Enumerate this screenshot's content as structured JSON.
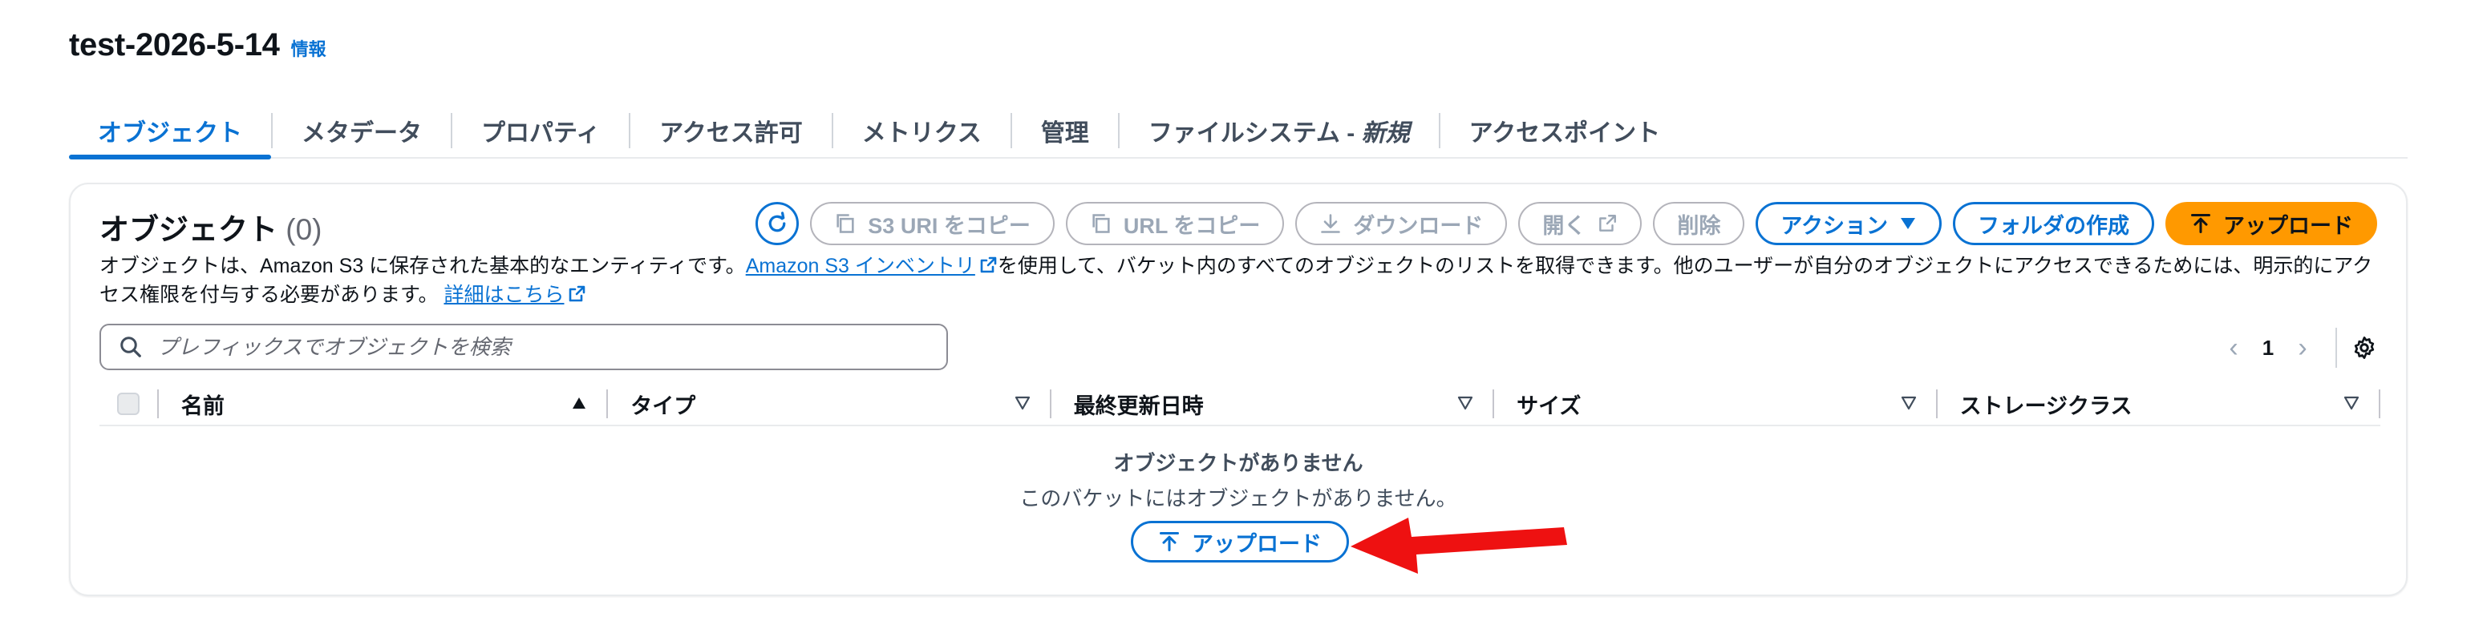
{
  "header": {
    "title": "test-2026-5-14",
    "info_link": "情報"
  },
  "tabs": [
    {
      "label": "オブジェクト",
      "active": true
    },
    {
      "label": "メタデータ"
    },
    {
      "label": "プロパティ"
    },
    {
      "label": "アクセス許可"
    },
    {
      "label": "メトリクス"
    },
    {
      "label": "管理"
    },
    {
      "label_prefix": "ファイルシステム - ",
      "label_italic": "新規"
    },
    {
      "label": "アクセスポイント"
    }
  ],
  "objects_panel": {
    "title": "オブジェクト",
    "count": "(0)",
    "toolbar": {
      "refresh_icon": "refresh-icon",
      "copy_s3_uri": "S3 URI をコピー",
      "copy_url": "URL をコピー",
      "download": "ダウンロード",
      "open": "開く",
      "delete": "削除",
      "actions": "アクション",
      "create_folder": "フォルダの作成",
      "upload": "アップロード"
    },
    "description": {
      "part1": "オブジェクトは、Amazon S3 に保存された基本的なエンティティです。",
      "inventory_link": "Amazon S3 インベントリ",
      "part2": "を使用して、バケット内のすべてのオブジェクトのリストを取得できます。他のユーザーが自分のオブジェクトにアクセスできるためには、明示的にアクセス権限を付与する必要があります。",
      "details_link": "詳細はこちら"
    },
    "search": {
      "placeholder": "プレフィックスでオブジェクトを検索",
      "value": ""
    },
    "pagination": {
      "current_page": "1"
    },
    "columns": [
      "名前",
      "タイプ",
      "最終更新日時",
      "サイズ",
      "ストレージクラス"
    ],
    "empty_state": {
      "title": "オブジェクトがありません",
      "description": "このバケットにはオブジェクトがありません。",
      "upload_button": "アップロード"
    }
  },
  "colors": {
    "accent": "#0972d3",
    "primary_button": "#ff9900",
    "annotation_arrow": "#ee1111"
  }
}
